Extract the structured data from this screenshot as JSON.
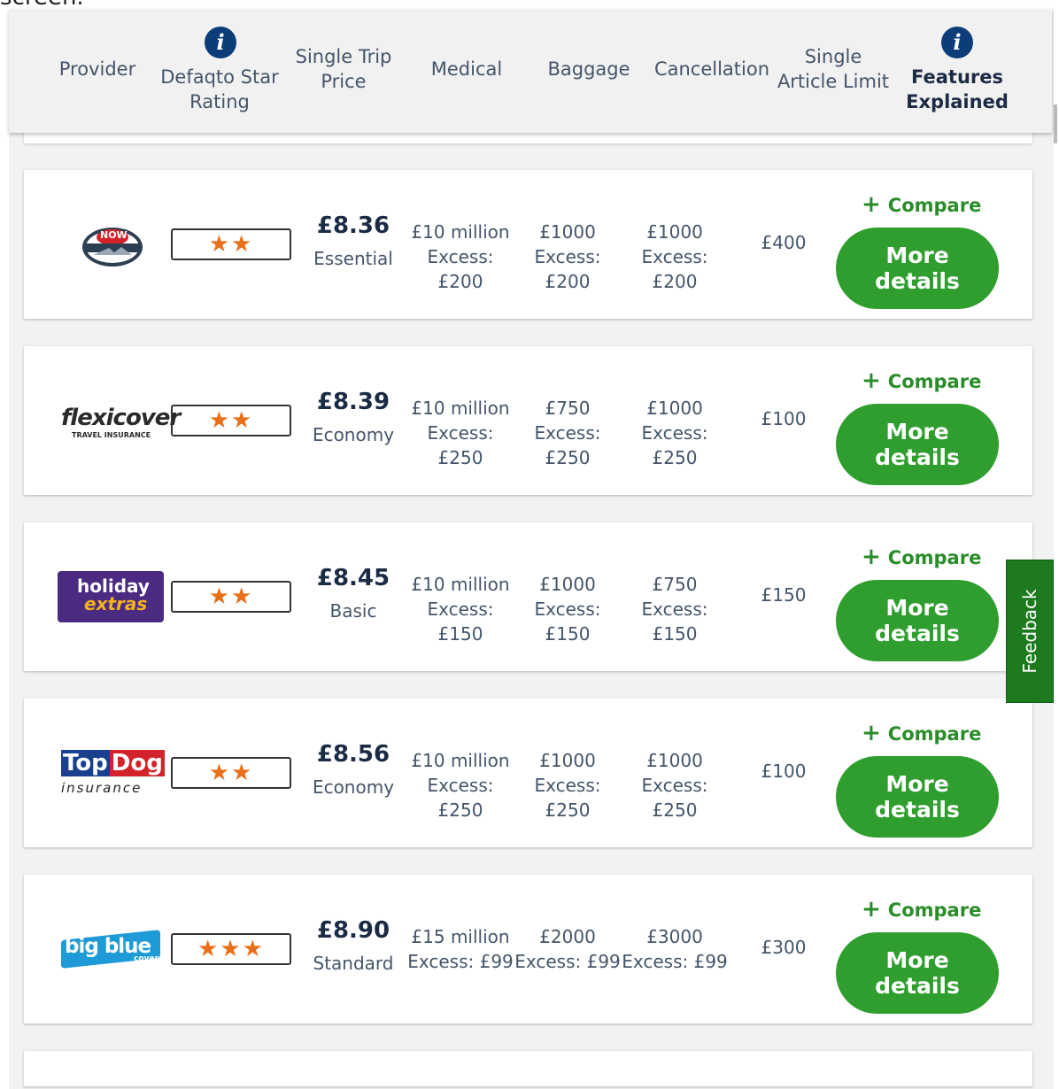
{
  "page": {
    "top_fragment": "screen."
  },
  "header": {
    "provider": "Provider",
    "star_rating": "Defaqto Star Rating",
    "single_trip_price": "Single Trip Price",
    "medical": "Medical",
    "baggage": "Baggage",
    "cancellation": "Cancellation",
    "single_article_limit": "Single Article Limit",
    "features_explained": "Features Explained",
    "info_icon_glyph": "i"
  },
  "colors": {
    "accent_green": "#2f9e2f",
    "star_orange": "#e8701a",
    "navy": "#0c3d78"
  },
  "actions": {
    "compare_plus": "+",
    "compare": "Compare",
    "more_details": "More details"
  },
  "feedback": "Feedback",
  "logos": {
    "now": "NOW",
    "flexicover": "flexicover",
    "flexicover_sub": "TRAVEL INSURANCE",
    "holiday_line1": "holiday",
    "holiday_line2": "extras",
    "topdog_top": "Top",
    "topdog_dog": "Dog",
    "topdog_sub": "insurance",
    "bigblue": "big blue",
    "bigblue_sub": "cover"
  },
  "rows": [
    {
      "provider": "Now Travel Insurance",
      "stars": "★★",
      "star_count": 2,
      "price": "£8.36",
      "tier": "Essential",
      "medical": "£10 million",
      "medical_excess": "Excess: £200",
      "baggage": "£1000",
      "baggage_excess": "Excess: £200",
      "cancellation": "£1000",
      "cancellation_excess": "Excess: £200",
      "single_article_limit": "£400"
    },
    {
      "provider": "Flexicover",
      "stars": "★★",
      "star_count": 2,
      "price": "£8.39",
      "tier": "Economy",
      "medical": "£10 million",
      "medical_excess": "Excess: £250",
      "baggage": "£750",
      "baggage_excess": "Excess: £250",
      "cancellation": "£1000",
      "cancellation_excess": "Excess: £250",
      "single_article_limit": "£100"
    },
    {
      "provider": "Holiday Extras",
      "stars": "★★",
      "star_count": 2,
      "price": "£8.45",
      "tier": "Basic",
      "medical": "£10 million",
      "medical_excess": "Excess: £150",
      "baggage": "£1000",
      "baggage_excess": "Excess: £150",
      "cancellation": "£750",
      "cancellation_excess": "Excess: £150",
      "single_article_limit": "£150"
    },
    {
      "provider": "TopDog Insurance",
      "stars": "★★",
      "star_count": 2,
      "price": "£8.56",
      "tier": "Economy",
      "medical": "£10 million",
      "medical_excess": "Excess: £250",
      "baggage": "£1000",
      "baggage_excess": "Excess: £250",
      "cancellation": "£1000",
      "cancellation_excess": "Excess: £250",
      "single_article_limit": "£100"
    },
    {
      "provider": "Big Blue Cover",
      "stars": "★★★",
      "star_count": 3,
      "price": "£8.90",
      "tier": "Standard",
      "medical": "£15 million",
      "medical_excess": "Excess: £99",
      "baggage": "£2000",
      "baggage_excess": "Excess: £99",
      "cancellation": "£3000",
      "cancellation_excess": "Excess: £99",
      "single_article_limit": "£300"
    }
  ]
}
